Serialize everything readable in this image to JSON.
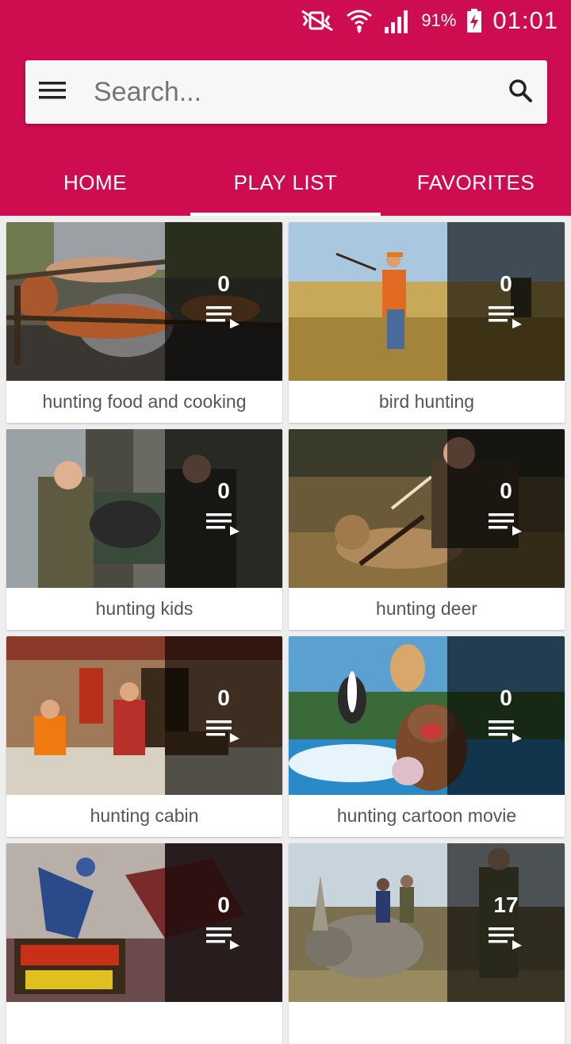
{
  "status": {
    "battery_percent": "91%",
    "time": "01:01",
    "icons": [
      "mute-vibrate-icon",
      "wifi-icon",
      "signal-icon",
      "battery-charging-icon"
    ]
  },
  "search": {
    "placeholder": "Search..."
  },
  "tabs": [
    {
      "label": "HOME",
      "active": false
    },
    {
      "label": "PLAY LIST",
      "active": true
    },
    {
      "label": "FAVORITES",
      "active": false
    }
  ],
  "playlists": [
    {
      "title": "hunting food and cooking",
      "count": "0"
    },
    {
      "title": "bird hunting",
      "count": "0"
    },
    {
      "title": "hunting kids",
      "count": "0"
    },
    {
      "title": "hunting deer",
      "count": "0"
    },
    {
      "title": "hunting cabin",
      "count": "0"
    },
    {
      "title": "hunting cartoon movie",
      "count": "0"
    },
    {
      "title": "",
      "count": "0"
    },
    {
      "title": "",
      "count": "17"
    }
  ],
  "colors": {
    "primary": "#cd0d4f",
    "background": "#eeeeee"
  }
}
